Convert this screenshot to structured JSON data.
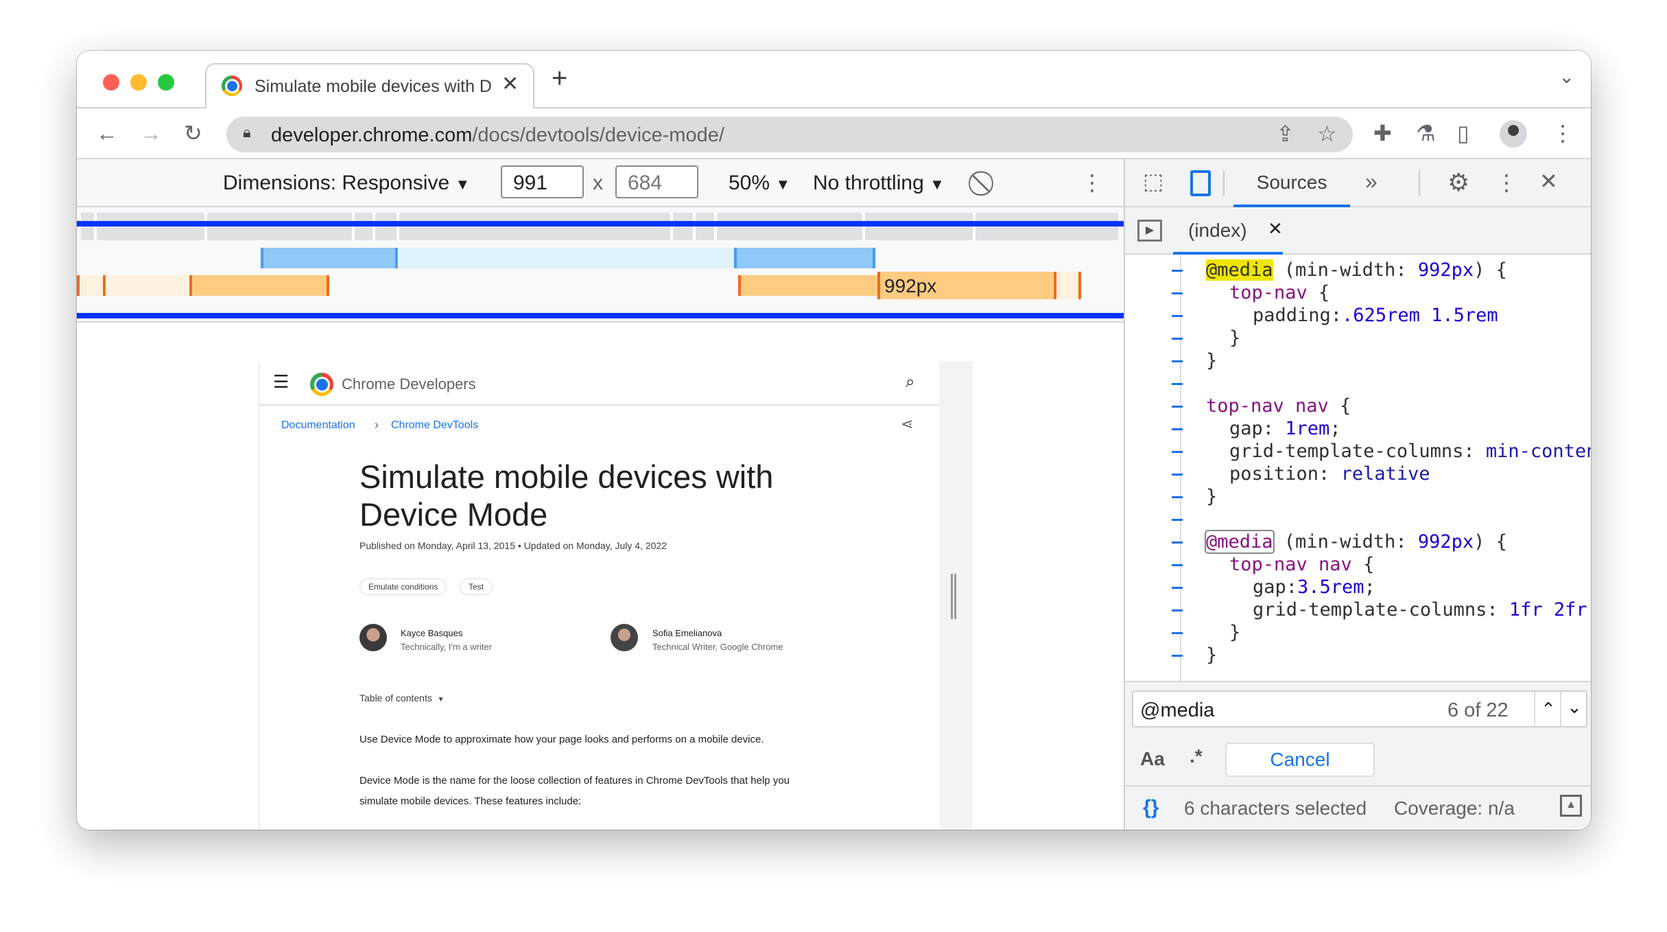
{
  "browser": {
    "tab_title": "Simulate mobile devices with Device Mode",
    "url_host": "developer.chrome.com",
    "url_path": "/docs/devtools/device-mode/"
  },
  "device_toolbar": {
    "dimensions_label": "Dimensions: Responsive",
    "width": "991",
    "times": "x",
    "height": "684",
    "zoom": "50%",
    "throttling": "No throttling"
  },
  "media_queries": {
    "label": "992px",
    "colors": {
      "max_width": "#90c8f8",
      "max_width_light": "#dff3fc",
      "min_width": "#ffcb80",
      "min_width_light": "#fff1df",
      "marker": "#f06a1d",
      "highlight_outline": "#0433ff"
    }
  },
  "page": {
    "site_name": "Chrome Developers",
    "breadcrumbs": [
      "Documentation",
      "Chrome DevTools"
    ],
    "title_line1": "Simulate mobile devices with",
    "title_line2": "Device Mode",
    "published": "Published on Monday, April 13, 2015 • Updated on Monday, July 4, 2022",
    "chips": [
      "Emulate conditions",
      "Test"
    ],
    "authors": [
      {
        "name": "Kayce Basques",
        "role": "Technically, I'm a writer"
      },
      {
        "name": "Sofia Emelianova",
        "role": "Technical Writer, Google Chrome"
      }
    ],
    "toc": "Table of contents",
    "para1": "Use Device Mode to approximate how your page looks and performs on a mobile device.",
    "para2a": "Device Mode is the name for the loose collection of features in Chrome DevTools that help you",
    "para2b": "simulate mobile devices. These features include:"
  },
  "devtools": {
    "panel_tab": "Sources",
    "file_tab": "(index)",
    "code": {
      "l1a": "@media",
      "l1b": " (min-width: ",
      "l1c": "992px",
      "l1d": ") {",
      "l2a": "top-nav",
      "l2b": " {",
      "l3a": "padding:",
      "l3b": ".625rem 1.5rem",
      "l4": "}",
      "l5": "}",
      "l7a": "top-nav nav",
      "l7b": " {",
      "l8a": "gap: ",
      "l8b": "1rem",
      "l8c": ";",
      "l9a": "grid-template-columns: ",
      "l9b": "min-content",
      "l10a": "position: ",
      "l10b": "relative",
      "l11": "}",
      "l13a": "@media",
      "l13b": " (min-width: ",
      "l13c": "992px",
      "l13d": ") {",
      "l14a": "top-nav nav",
      "l14b": " {",
      "l15a": "gap:",
      "l15b": "3.5rem",
      "l15c": ";",
      "l16a": "grid-template-columns: ",
      "l16b": "1fr 2fr",
      "l17": "}",
      "l18": "}"
    },
    "search": {
      "query": "@media",
      "count": "6 of 22"
    },
    "options": {
      "match_case": "Aa",
      "regex": ".*",
      "cancel": "Cancel"
    },
    "status": {
      "format": "{}",
      "selection": "6 characters selected",
      "coverage": "Coverage: n/a"
    }
  }
}
